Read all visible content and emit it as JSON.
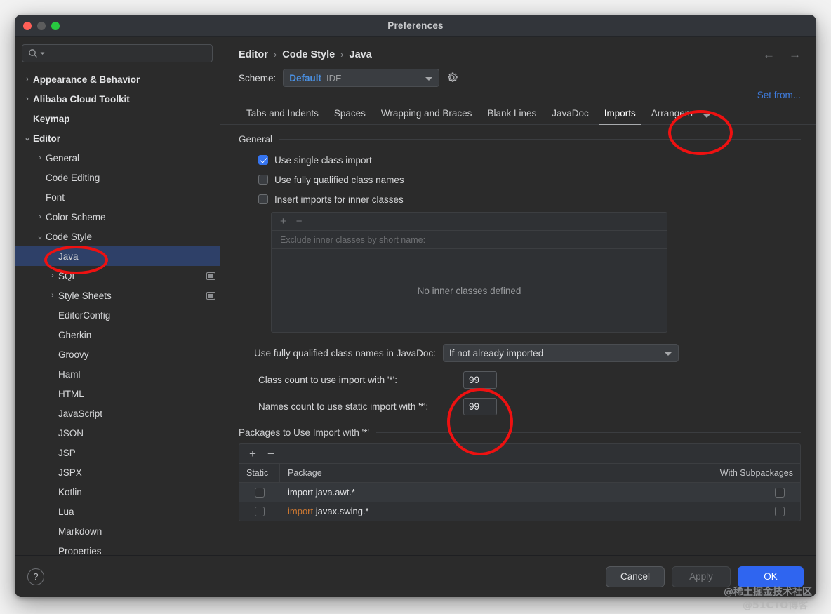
{
  "window": {
    "title": "Preferences",
    "traffic": [
      "close",
      "minimize",
      "zoom"
    ]
  },
  "sidebar": {
    "search": {
      "placeholder": "",
      "value": "",
      "icon": "search-icon"
    },
    "items": [
      {
        "label": "Appearance & Behavior",
        "twisty": "›",
        "indent": 0,
        "bold": true,
        "selected": false,
        "module_icon": false
      },
      {
        "label": "Alibaba Cloud Toolkit",
        "twisty": "›",
        "indent": 0,
        "bold": true,
        "selected": false,
        "module_icon": false
      },
      {
        "label": "Keymap",
        "twisty": "",
        "indent": 0,
        "bold": true,
        "selected": false,
        "module_icon": false
      },
      {
        "label": "Editor",
        "twisty": "⌄",
        "indent": 0,
        "bold": true,
        "selected": false,
        "module_icon": false
      },
      {
        "label": "General",
        "twisty": "›",
        "indent": 1,
        "bold": false,
        "selected": false,
        "module_icon": false
      },
      {
        "label": "Code Editing",
        "twisty": "",
        "indent": 1,
        "bold": false,
        "selected": false,
        "module_icon": false
      },
      {
        "label": "Font",
        "twisty": "",
        "indent": 1,
        "bold": false,
        "selected": false,
        "module_icon": false
      },
      {
        "label": "Color Scheme",
        "twisty": "›",
        "indent": 1,
        "bold": false,
        "selected": false,
        "module_icon": false
      },
      {
        "label": "Code Style",
        "twisty": "⌄",
        "indent": 1,
        "bold": false,
        "selected": false,
        "module_icon": false
      },
      {
        "label": "Java",
        "twisty": "",
        "indent": 2,
        "bold": false,
        "selected": true,
        "module_icon": false
      },
      {
        "label": "SQL",
        "twisty": "›",
        "indent": 2,
        "bold": false,
        "selected": false,
        "module_icon": true
      },
      {
        "label": "Style Sheets",
        "twisty": "›",
        "indent": 2,
        "bold": false,
        "selected": false,
        "module_icon": true
      },
      {
        "label": "EditorConfig",
        "twisty": "",
        "indent": 2,
        "bold": false,
        "selected": false,
        "module_icon": false
      },
      {
        "label": "Gherkin",
        "twisty": "",
        "indent": 2,
        "bold": false,
        "selected": false,
        "module_icon": false
      },
      {
        "label": "Groovy",
        "twisty": "",
        "indent": 2,
        "bold": false,
        "selected": false,
        "module_icon": false
      },
      {
        "label": "Haml",
        "twisty": "",
        "indent": 2,
        "bold": false,
        "selected": false,
        "module_icon": false
      },
      {
        "label": "HTML",
        "twisty": "",
        "indent": 2,
        "bold": false,
        "selected": false,
        "module_icon": false
      },
      {
        "label": "JavaScript",
        "twisty": "",
        "indent": 2,
        "bold": false,
        "selected": false,
        "module_icon": false
      },
      {
        "label": "JSON",
        "twisty": "",
        "indent": 2,
        "bold": false,
        "selected": false,
        "module_icon": false
      },
      {
        "label": "JSP",
        "twisty": "",
        "indent": 2,
        "bold": false,
        "selected": false,
        "module_icon": false
      },
      {
        "label": "JSPX",
        "twisty": "",
        "indent": 2,
        "bold": false,
        "selected": false,
        "module_icon": false
      },
      {
        "label": "Kotlin",
        "twisty": "",
        "indent": 2,
        "bold": false,
        "selected": false,
        "module_icon": false
      },
      {
        "label": "Lua",
        "twisty": "",
        "indent": 2,
        "bold": false,
        "selected": false,
        "module_icon": false
      },
      {
        "label": "Markdown",
        "twisty": "",
        "indent": 2,
        "bold": false,
        "selected": false,
        "module_icon": false
      },
      {
        "label": "Properties",
        "twisty": "",
        "indent": 2,
        "bold": false,
        "selected": false,
        "module_icon": false
      }
    ]
  },
  "main": {
    "breadcrumb": [
      "Editor",
      "Code Style",
      "Java"
    ],
    "breadcrumb_separator": "›",
    "nav": {
      "back": "←",
      "forward": "→"
    },
    "scheme": {
      "label": "Scheme:",
      "value_primary": "Default",
      "value_secondary": "IDE",
      "gear_icon": "gear-icon"
    },
    "set_from_link": "Set from...",
    "tabs": [
      {
        "label": "Tabs and Indents",
        "active": false
      },
      {
        "label": "Spaces",
        "active": false
      },
      {
        "label": "Wrapping and Braces",
        "active": false
      },
      {
        "label": "Blank Lines",
        "active": false
      },
      {
        "label": "JavaDoc",
        "active": false
      },
      {
        "label": "Imports",
        "active": true
      },
      {
        "label": "Arrangem",
        "active": false
      }
    ],
    "general": {
      "title": "General",
      "checkboxes": [
        {
          "label": "Use single class import",
          "checked": true
        },
        {
          "label": "Use fully qualified class names",
          "checked": false
        },
        {
          "label": "Insert imports for inner classes",
          "checked": false
        }
      ]
    },
    "inner_classes": {
      "add_icon": "+",
      "remove_icon": "−",
      "column_header": "Exclude inner classes by short name:",
      "empty_text": "No inner classes defined"
    },
    "javadoc_fqn": {
      "label": "Use fully qualified class names in JavaDoc:",
      "value": "If not already imported"
    },
    "counts": [
      {
        "label": "Class count to use import with '*':",
        "value": "99"
      },
      {
        "label": "Names count to use static import with '*':",
        "value": "99"
      }
    ],
    "packages": {
      "title": "Packages to Use Import with '*'",
      "add_icon": "+",
      "remove_icon": "−",
      "columns": [
        "Static",
        "Package",
        "With Subpackages"
      ],
      "rows": [
        {
          "static": false,
          "keyword": "",
          "package": "import java.awt.*",
          "with_subpackages": false
        },
        {
          "static": false,
          "keyword": "import",
          "package": "javax.swing.*",
          "with_subpackages": false
        }
      ]
    }
  },
  "footer": {
    "help_icon": "?",
    "buttons": [
      {
        "label": "Cancel",
        "style": "normal"
      },
      {
        "label": "Apply",
        "style": "disabled"
      },
      {
        "label": "OK",
        "style": "primary"
      }
    ]
  },
  "annotations": {
    "color": "#ee1111",
    "ellipses": [
      "imports-tab",
      "java-sidebar-item",
      "count-fields"
    ]
  },
  "watermarks": [
    "@稀土掘金技术社区",
    "@51CTO博客"
  ]
}
